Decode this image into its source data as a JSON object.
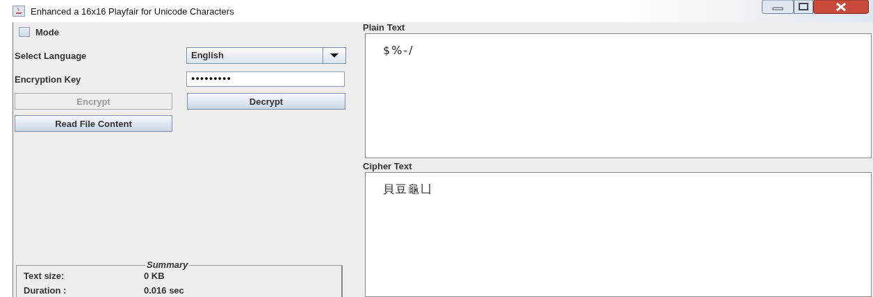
{
  "window": {
    "title": "Enhanced a 16x16 Playfair for Unicode Characters"
  },
  "controls": {
    "mode": {
      "label": "Mode",
      "checked": false
    },
    "language": {
      "label": "Select Language",
      "value": "English"
    },
    "key": {
      "label": "Encryption Key",
      "value": "●●●●●●●●●"
    },
    "buttons": [
      {
        "label": "Encrypt",
        "disabled": true
      },
      {
        "label": "Decrypt",
        "disabled": false
      },
      {
        "label": "Read File Content",
        "disabled": false
      }
    ]
  },
  "summary": {
    "title": "Summary",
    "rows": [
      {
        "label": "Text size:",
        "value": "0 KB"
      },
      {
        "label": "Duration :",
        "value": "0.016 sec"
      }
    ]
  },
  "plain_text": {
    "label": "Plain Text",
    "value": "$%-/"
  },
  "cipher_text": {
    "label": "Cipher Text",
    "value": "貝豆龜凵"
  }
}
